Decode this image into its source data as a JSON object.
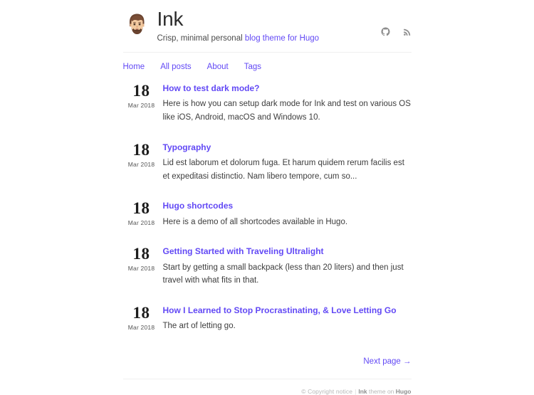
{
  "header": {
    "title": "Ink",
    "subtitle_prefix": "Crisp, minimal personal ",
    "subtitle_link": "blog theme for Hugo",
    "avatar_name": "avatar-bearded-man",
    "social": [
      {
        "name": "github-icon",
        "label": "GitHub"
      },
      {
        "name": "rss-icon",
        "label": "RSS"
      }
    ]
  },
  "nav": {
    "items": [
      {
        "label": "Home"
      },
      {
        "label": "All posts"
      },
      {
        "label": "About"
      },
      {
        "label": "Tags"
      }
    ]
  },
  "posts": [
    {
      "day": "18",
      "month": "Mar 2018",
      "title": "How to test dark mode?",
      "excerpt": "Here is how you can setup dark mode for Ink and test on various OS like iOS, Android, macOS and Windows 10."
    },
    {
      "day": "18",
      "month": "Mar 2018",
      "title": "Typography",
      "excerpt": "Lid est laborum et dolorum fuga. Et harum quidem rerum facilis est et expeditasi distinctio. Nam libero tempore, cum so..."
    },
    {
      "day": "18",
      "month": "Mar 2018",
      "title": "Hugo shortcodes",
      "excerpt": "Here is a demo of all shortcodes available in Hugo."
    },
    {
      "day": "18",
      "month": "Mar 2018",
      "title": "Getting Started with Traveling Ultralight",
      "excerpt": "Start by getting a small backpack (less than 20 liters) and then just travel with what fits in that."
    },
    {
      "day": "18",
      "month": "Mar 2018",
      "title": "How I Learned to Stop Procrastinating, & Love Letting Go",
      "excerpt": "The art of letting go."
    }
  ],
  "pagination": {
    "next_label": "Next page →"
  },
  "footer": {
    "copyright": "© Copyright notice",
    "separator": "|",
    "theme_link": "Ink",
    "theme_text": " theme on ",
    "engine_link": "Hugo"
  },
  "colors": {
    "link": "#6249f5",
    "text": "#333333",
    "muted": "#b8b8b8",
    "rule": "#f0f0f0"
  }
}
